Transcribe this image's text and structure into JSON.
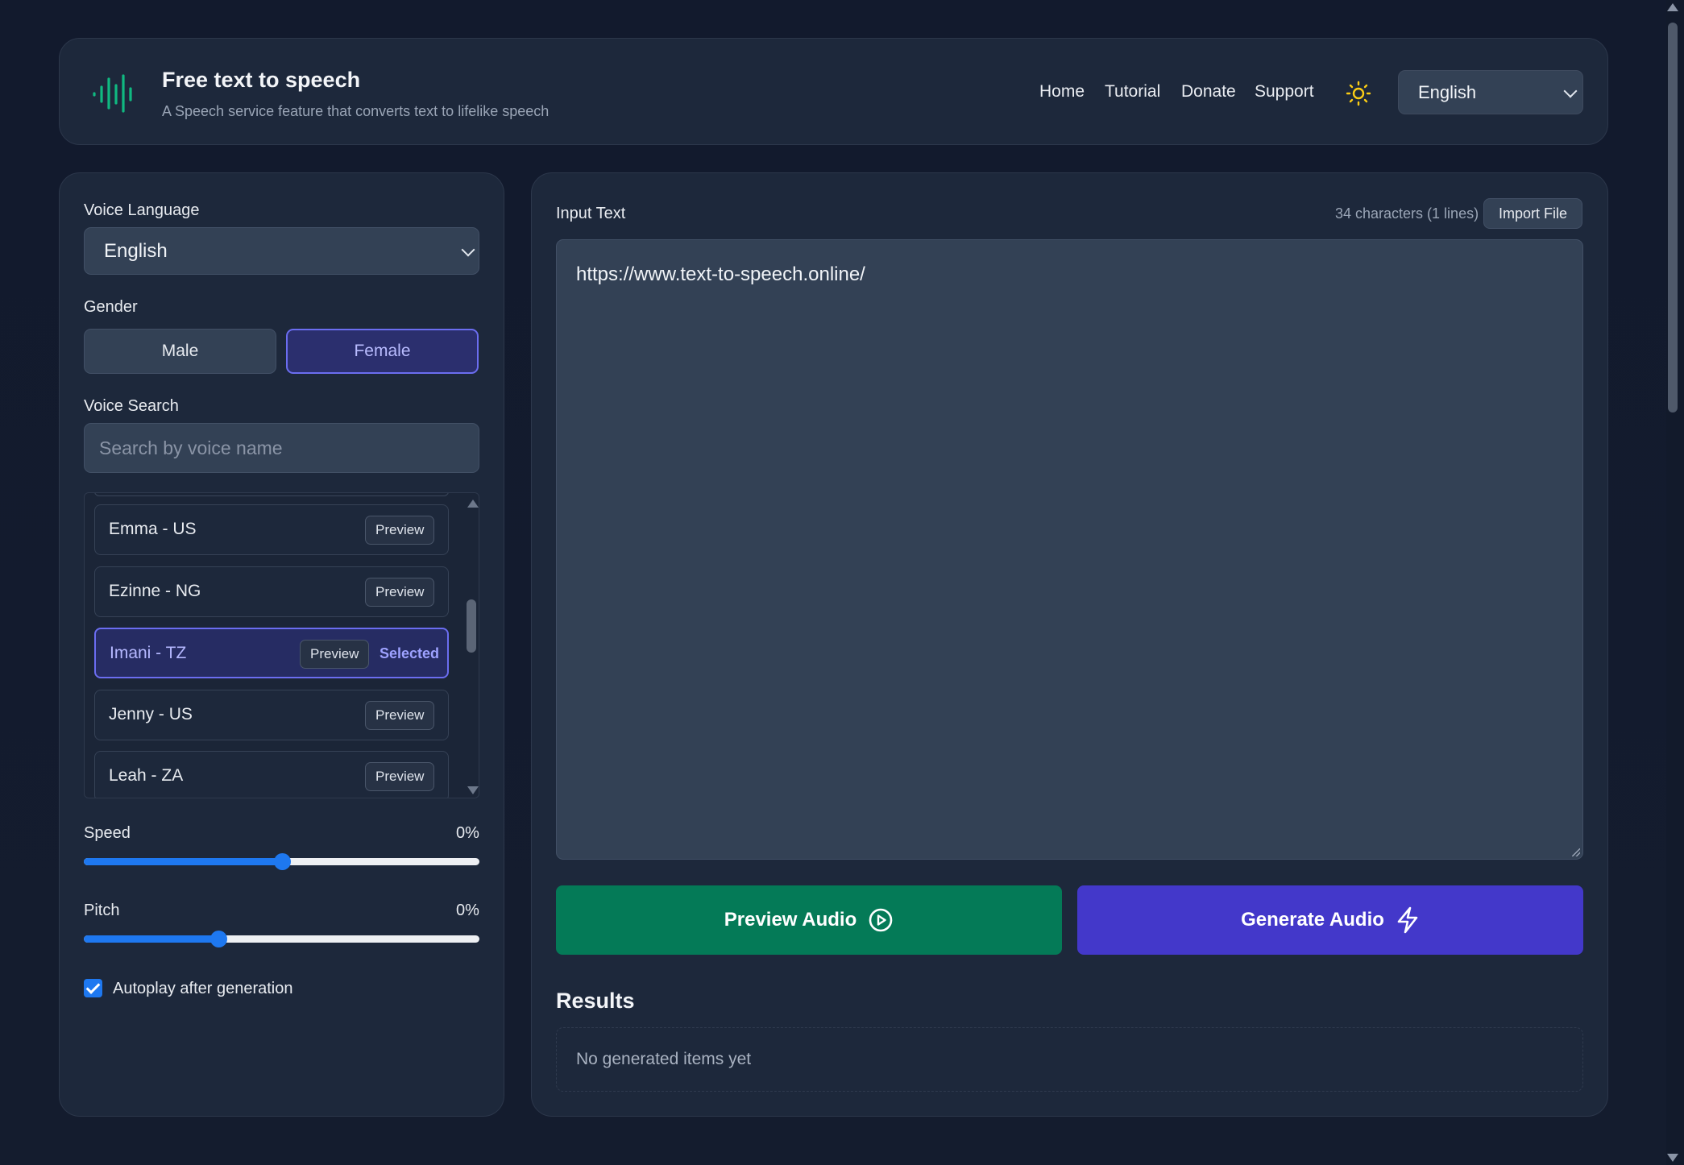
{
  "header": {
    "title": "Free text to speech",
    "subtitle": "A Speech service feature that converts text to lifelike speech",
    "nav": [
      "Home",
      "Tutorial",
      "Donate",
      "Support"
    ],
    "language_select": "English",
    "logo_icon": "sound-wave-icon",
    "theme_icon": "sun-icon",
    "colors": {
      "logo": "#10b981",
      "sun": "#facc15"
    }
  },
  "left": {
    "voice_language_label": "Voice Language",
    "voice_language_value": "English",
    "gender_label": "Gender",
    "gender_options": [
      "Male",
      "Female"
    ],
    "gender_selected": "Female",
    "voice_search_label": "Voice Search",
    "voice_search_placeholder": "Search by voice name",
    "voices": [
      {
        "name": "Emma - US",
        "preview": "Preview"
      },
      {
        "name": "Ezinne - NG",
        "preview": "Preview"
      },
      {
        "name": "Imani - TZ",
        "preview": "Preview",
        "selected": "Selected"
      },
      {
        "name": "Jenny - US",
        "preview": "Preview"
      },
      {
        "name": "Leah - ZA",
        "preview": "Preview"
      }
    ],
    "speed_label": "Speed",
    "speed_value": "0%",
    "speed_level": 0.5,
    "pitch_label": "Pitch",
    "pitch_value": "0%",
    "pitch_level": 0.34,
    "autoplay_label": "Autoplay after generation",
    "autoplay_checked": true
  },
  "right": {
    "input_label": "Input Text",
    "char_count": "34 characters (1 lines)",
    "import_button": "Import File",
    "input_text": "https://www.text-to-speech.online/",
    "preview_button": "Preview Audio",
    "generate_button": "Generate Audio",
    "results_title": "Results",
    "results_empty": "No generated items yet",
    "colors": {
      "preview": "#047a57",
      "generate": "#4338ca",
      "accent": "#6b6df0"
    }
  }
}
